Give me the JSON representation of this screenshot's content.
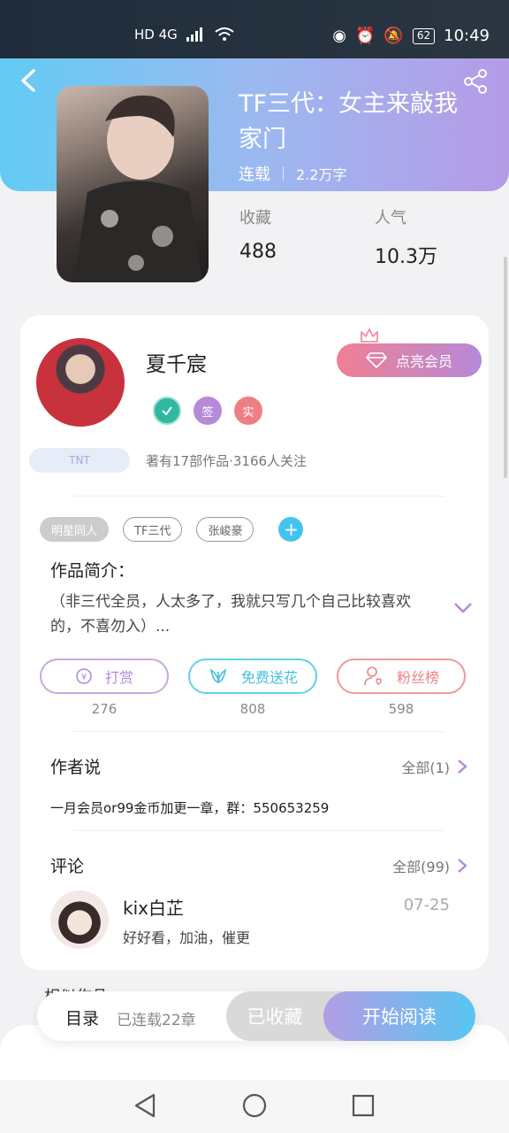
{
  "status_bar": {
    "network_labels": "HD 4G",
    "battery": "62",
    "time": "10:49"
  },
  "book": {
    "title": "TF三代：女主来敲我家门",
    "status": "连载",
    "words": "2.2万字",
    "collect_label": "收藏",
    "collect_value": "488",
    "popularity_label": "人气",
    "popularity_value": "10.3万"
  },
  "author": {
    "name": "夏千宸",
    "vip_button": "点亮会员",
    "badges": [
      "签",
      "实"
    ],
    "fan_tag": "TNT",
    "stats": "著有17部作品·3166人关注"
  },
  "tags": [
    "明星同人",
    "TF三代",
    "张峻豪"
  ],
  "intro": {
    "title": "作品简介：",
    "text": "（非三代全员，人太多了，我就只写几个自己比较喜欢的，不喜勿入）..."
  },
  "actions": [
    {
      "label": "打赏",
      "count": "276"
    },
    {
      "label": "免费送花",
      "count": "808"
    },
    {
      "label": "粉丝榜",
      "count": "598"
    }
  ],
  "author_says": {
    "title": "作者说",
    "more": "全部(1)",
    "text": "一月会员or99金币加更一章，群：550653259"
  },
  "comments": {
    "title": "评论",
    "more": "全部(99)",
    "items": [
      {
        "user": "kix白芷",
        "date": "07-25",
        "text": "好好看，加油，催更"
      }
    ]
  },
  "peek_section": "相似作品",
  "bottom_bar": {
    "toc": "目录",
    "serial": "已连载22章",
    "collected": "已收藏",
    "read": "开始阅读"
  },
  "colors": {
    "header_start": "#62cbf3",
    "header_end": "#b59be6",
    "accent_purple": "#b689d8",
    "accent_blue": "#45c3ef"
  }
}
